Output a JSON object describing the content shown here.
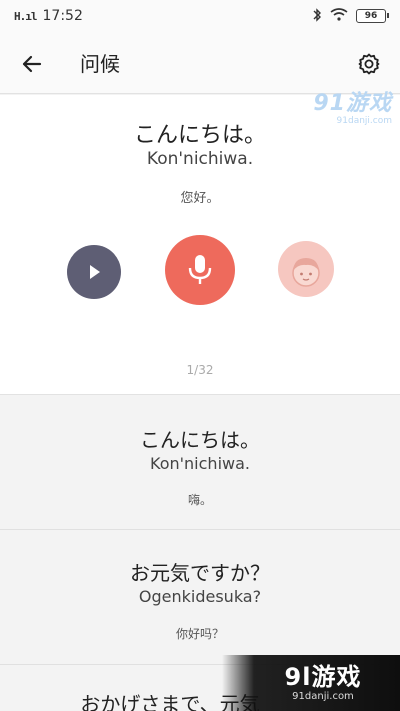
{
  "status_bar": {
    "signal": "H.ıl",
    "time": "17:52",
    "battery": "96"
  },
  "header": {
    "title": "问候"
  },
  "current_phrase": {
    "japanese": "こんにちは。",
    "romaji": "Kon'nichiwa.",
    "chinese": "您好。",
    "counter": "1/32"
  },
  "phrase_list": [
    {
      "japanese": "こんにちは。",
      "romaji": "Kon'nichiwa.",
      "chinese": "嗨。"
    },
    {
      "japanese": "お元気ですか？",
      "romaji": "Ogenkidesuka?",
      "chinese": "你好吗？"
    },
    {
      "japanese": "おかげさまで、元気"
    }
  ],
  "watermarks": {
    "top_logo": "91游戏",
    "top_url": "91danji.com",
    "bottom_logo": "9l游戏",
    "bottom_url": "91danji.com"
  },
  "colors": {
    "play": "#5e5e74",
    "mic": "#ee6a5c",
    "avatar": "#f6c7c0"
  },
  "icons": [
    "back-arrow-icon",
    "gear-icon",
    "play-icon",
    "microphone-icon",
    "avatar-icon",
    "bluetooth-icon",
    "wifi-icon"
  ]
}
